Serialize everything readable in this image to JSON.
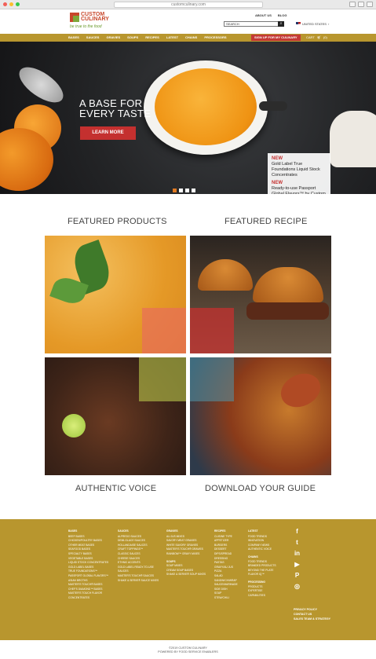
{
  "browser": {
    "url": "customculinary.com"
  },
  "header": {
    "logo_brand": "CUSTOM CULINARY",
    "logo_tagline": "be true to the food",
    "top_links": [
      "ABOUT US",
      "BLOG"
    ],
    "search_placeholder": "SEARCH",
    "country": "UNITED STATES"
  },
  "nav": {
    "items": [
      "BASES",
      "SAUCES",
      "GRAVIES",
      "SOUPS",
      "RECIPES",
      "LATEST",
      "CHAINS",
      "PROCESSORS"
    ],
    "signup_label": "SIGN UP FOR MY CULINARY",
    "cart_label": "CART",
    "cart_count": "(0)"
  },
  "hero": {
    "title_line1": "A BASE FOR",
    "title_line2": "EVERY TASTE",
    "cta_label": "LEARN MORE",
    "card": [
      {
        "badge": "NEW",
        "text": "Gold Label True Foundations Liquid Stock Concentrates"
      },
      {
        "badge": "NEW",
        "text": "Ready-to-use Passport Global Flavors™ by Custom Culinary Asian Broths"
      }
    ],
    "slides_total": 4,
    "active_slide": 1
  },
  "sections": {
    "featured_products": "FEATURED PRODUCTS",
    "featured_recipe": "FEATURED RECIPE",
    "authentic_voice": "AUTHENTIC VOICE",
    "download_guide": "DOWNLOAD YOUR GUIDE"
  },
  "footer": {
    "columns": [
      {
        "heading": "BASES",
        "items": [
          "BEEF BASES",
          "CHICKEN/POULTRY BASES",
          "OTHER MEAT BASES",
          "SEAFOOD BASES",
          "SPECIALTY BASES",
          "VEGETABLE BASES",
          "LIQUID STOCK CONCENTRATES",
          "GOLD LABEL BASES",
          "TRUE FOUNDATIONS™",
          "PASSPORT GLOBAL FLAVORS™ ASIAN BROTHS",
          "MASTER'S TOUCH® BASES",
          "CHEF'S DIAMOND™ BASES",
          "MASTER'S TOUCH FLAVOR CONCENTRATES"
        ]
      },
      {
        "heading": "SAUCES",
        "items": [
          "ALFREDO SAUCES",
          "DEMI-GLACE SAUCES",
          "HOLLANDAISE SAUCES",
          "CRAFT TOPPINGS™",
          "CLASSIC SAUCES",
          "CHEESE SAUCES",
          "ETHNIC ACCENTS",
          "GOLD LABEL READY-TO-USE SAUCES",
          "MASTER'S TOUCH® SAUCES",
          "SHAKE & SERVE® SAUCE MIXES"
        ]
      },
      {
        "heading": "GRAVIES",
        "items": [
          "AU JUS MIXES",
          "SAVORY MEAT GRAVIES",
          "WHITE SAVORY GRAVIES",
          "MASTER'S TOUCH® GRAVIES",
          "RAINBOW™ GRAVY MIXES"
        ],
        "heading2": "SOUPS",
        "items2": [
          "SOUP MIXES",
          "CREAM SOUP BASES",
          "SHAKE & SERVE® SOUP MIXES"
        ]
      },
      {
        "heading": "RECIPES",
        "items": [
          "CUISINE TYPE",
          "APPETIZER",
          "BURGERS",
          "DESSERT",
          "DIPS/SPREAD",
          "DRESSING",
          "PASTAS",
          "GRAVY/AU JUS",
          "PIZZA",
          "SALAD",
          "SANDWICH/WRAP",
          "SAUCE/MARINADE",
          "SIDE DISH",
          "SOUP",
          "STEW/CHILI"
        ]
      },
      {
        "heading": "LATEST",
        "items": [
          "FOOD TRENDS",
          "INNOVATION",
          "COMPANY NEWS",
          "AUTHENTIC VOICE"
        ],
        "heading2": "CHAINS",
        "items2": [
          "FOOD TRENDS",
          "BRANDED PRODUCTS",
          "BEYOND THE PLATE",
          "FLAVOR IQ™"
        ],
        "heading3": "PROCESSING",
        "items3": [
          "PRODUCTS",
          "EXPERTISE",
          "CAPABILITIES"
        ]
      }
    ],
    "social_icons": [
      "facebook-icon",
      "twitter-icon",
      "linkedin-icon",
      "youtube-icon",
      "pinterest-icon",
      "instagram-icon"
    ],
    "social_glyphs": [
      "f",
      "t",
      "in",
      "▶",
      "P",
      "◎"
    ],
    "policy_links": [
      "PRIVACY POLICY",
      "CONTACT US",
      "SALES TEAM & STRATEGY"
    ]
  },
  "copyright": {
    "line1": "©2019 CUSTOM CULINARY",
    "line2": "POWERED BY FOOD SERVICE ENABLERS"
  },
  "colors": {
    "gold": "#b8962e",
    "red": "#c4302f",
    "orange_dot": "#e07a23"
  }
}
